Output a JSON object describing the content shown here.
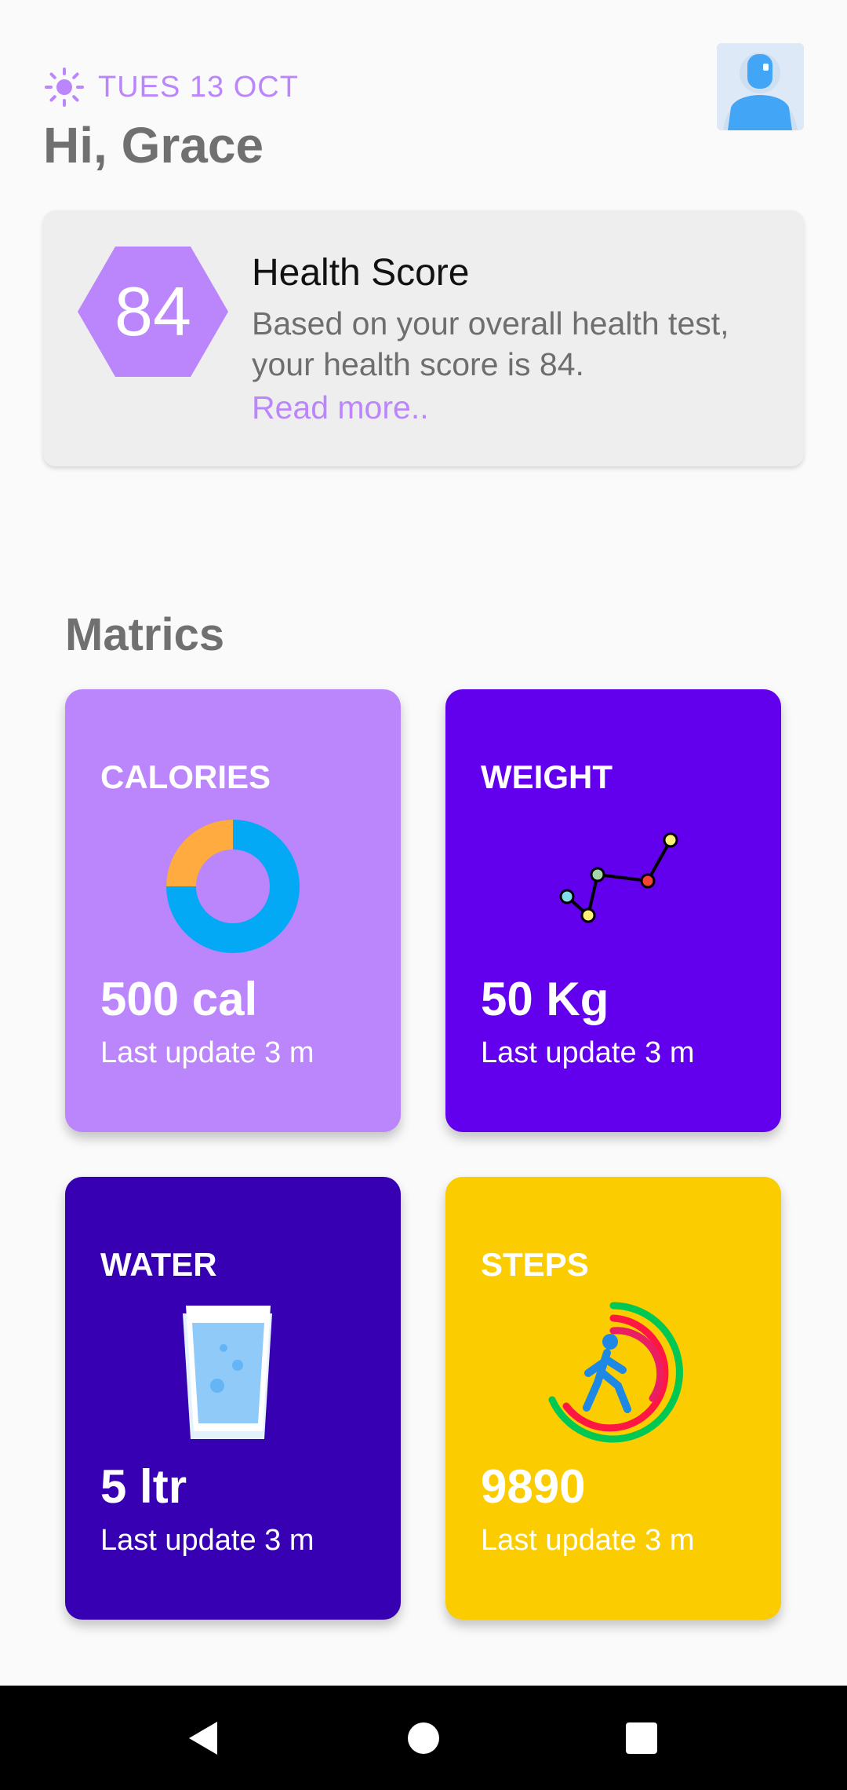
{
  "header": {
    "date": "TUES 13 OCT",
    "greeting": "Hi, Grace",
    "sun_icon": "sun-icon",
    "avatar_icon": "user-avatar-icon"
  },
  "health_score": {
    "value": "84",
    "title": "Health Score",
    "description": "Based on your overall health test, your health score is 84.",
    "read_more": "Read more..",
    "badge_shape": "hexagon"
  },
  "metrics": {
    "title": "Matrics",
    "tiles": [
      {
        "label": "CALORIES",
        "value": "500 cal",
        "update": "Last update 3 m",
        "icon": "donut-chart-icon",
        "color": "#bb86fc"
      },
      {
        "label": "WEIGHT",
        "value": "50 Kg",
        "update": "Last update 3 m",
        "icon": "line-graph-icon",
        "color": "#6200ee"
      },
      {
        "label": "WATER",
        "value": "5 ltr",
        "update": "Last update 3 m",
        "icon": "water-glass-icon",
        "color": "#3700b3"
      },
      {
        "label": "STEPS",
        "value": "9890",
        "update": "Last update 3 m",
        "icon": "walking-rings-icon",
        "color": "#fbcc00"
      }
    ]
  },
  "colors": {
    "accent": "#bb86fc",
    "primary": "#6200ee",
    "primary_dark": "#3700b3",
    "yellow": "#fbcc00",
    "card_bg": "#eeeeee"
  },
  "nav": {
    "back_icon": "back-triangle-icon",
    "home_icon": "home-circle-icon",
    "recents_icon": "recents-square-icon"
  }
}
